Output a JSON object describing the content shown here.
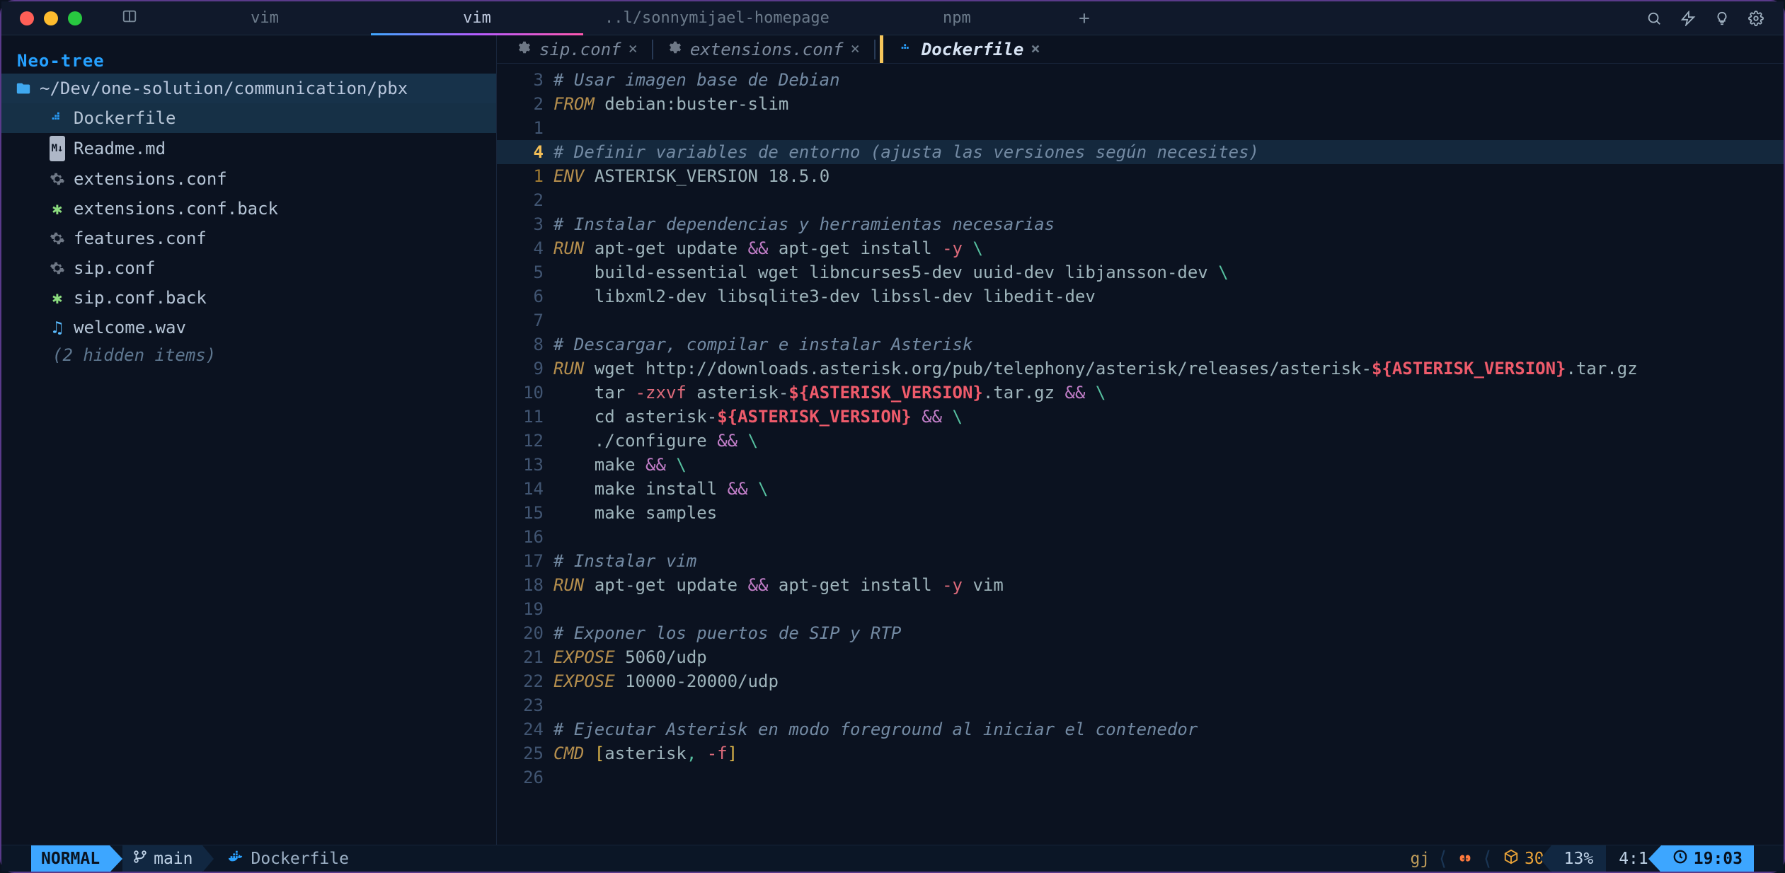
{
  "titlebar": {
    "tabs": [
      {
        "label": "vim",
        "active": false
      },
      {
        "label": "vim",
        "active": true
      },
      {
        "label": "..l/sonnymijael-homepage",
        "active": false
      },
      {
        "label": "npm",
        "active": false
      }
    ]
  },
  "sidebar": {
    "title": "Neo-tree",
    "root": "~/Dev/one-solution/communication/pbx",
    "items": [
      {
        "icon": "docker",
        "label": "Dockerfile",
        "selected": true
      },
      {
        "icon": "md",
        "label": "Readme.md"
      },
      {
        "icon": "gear",
        "label": "extensions.conf"
      },
      {
        "icon": "star",
        "label": "extensions.conf.back"
      },
      {
        "icon": "gear",
        "label": "features.conf"
      },
      {
        "icon": "gear",
        "label": "sip.conf"
      },
      {
        "icon": "star",
        "label": "sip.conf.back"
      },
      {
        "icon": "audio",
        "label": "welcome.wav"
      }
    ],
    "hidden": "(2 hidden items)"
  },
  "buffers": {
    "tabs": [
      {
        "icon": "gear",
        "name": "sip.conf",
        "close": true
      },
      {
        "icon": "gear",
        "name": "extensions.conf",
        "close": true
      },
      {
        "icon": "docker",
        "name": "Dockerfile",
        "close": true,
        "active": true,
        "modified": true
      }
    ]
  },
  "code": {
    "current_gutter": "4",
    "lines": [
      {
        "g": "3",
        "html": "<span class='tok-comment'># Usar imagen base de Debian</span>"
      },
      {
        "g": "2",
        "html": "<span class='tok-kw'>FROM</span> <span class='tok-text'>debian:buster-slim</span>"
      },
      {
        "g": "1",
        "html": ""
      },
      {
        "g": "4",
        "current": true,
        "html": "<span class='tok-comment'># Definir variables de entorno (ajusta las versiones según necesites)</span>"
      },
      {
        "g": "1",
        "near": true,
        "html": "<span class='tok-kw'>ENV</span> <span class='tok-text'>ASTERISK_VERSION 18.5.0</span>"
      },
      {
        "g": "2",
        "html": ""
      },
      {
        "g": "3",
        "html": "<span class='tok-comment'># Instalar dependencias y herramientas necesarias</span>"
      },
      {
        "g": "4",
        "html": "<span class='tok-kw'>RUN</span> <span class='tok-text'>apt-get update</span> <span class='tok-opamp'>&amp;&amp;</span> <span class='tok-text'>apt-get install </span><span class='tok-flag'>-y</span> <span class='tok-op'>\\</span>"
      },
      {
        "g": "5",
        "html": "    <span class='tok-text'>build-essential wget libncurses5-dev uuid-dev libjansson-dev</span> <span class='tok-op'>\\</span>"
      },
      {
        "g": "6",
        "html": "    <span class='tok-text'>libxml2-dev libsqlite3-dev libssl-dev libedit-dev</span>"
      },
      {
        "g": "7",
        "html": ""
      },
      {
        "g": "8",
        "html": "<span class='tok-comment'># Descargar, compilar e instalar Asterisk</span>"
      },
      {
        "g": "9",
        "html": "<span class='tok-kw'>RUN</span> <span class='tok-text'>wget http://downloads.asterisk.org/pub/telephony/asterisk/releases/asterisk-</span><span class='tok-var'>${ASTERISK_VERSION}</span><span class='tok-text'>.tar.gz</span>"
      },
      {
        "g": "10",
        "html": "    <span class='tok-text'>tar </span><span class='tok-flag'>-zxvf</span> <span class='tok-text'>asterisk-</span><span class='tok-var'>${ASTERISK_VERSION}</span><span class='tok-text'>.tar.gz</span> <span class='tok-opamp'>&amp;&amp;</span> <span class='tok-op'>\\</span>"
      },
      {
        "g": "11",
        "html": "    <span class='tok-text'>cd asterisk-</span><span class='tok-var'>${ASTERISK_VERSION}</span> <span class='tok-opamp'>&amp;&amp;</span> <span class='tok-op'>\\</span>"
      },
      {
        "g": "12",
        "html": "    <span class='tok-text'>./configure</span> <span class='tok-opamp'>&amp;&amp;</span> <span class='tok-op'>\\</span>"
      },
      {
        "g": "13",
        "html": "    <span class='tok-text'>make</span> <span class='tok-opamp'>&amp;&amp;</span> <span class='tok-op'>\\</span>"
      },
      {
        "g": "14",
        "html": "    <span class='tok-text'>make install</span> <span class='tok-opamp'>&amp;&amp;</span> <span class='tok-op'>\\</span>"
      },
      {
        "g": "15",
        "html": "    <span class='tok-text'>make samples</span>"
      },
      {
        "g": "16",
        "html": ""
      },
      {
        "g": "17",
        "html": "<span class='tok-comment'># Instalar vim</span>"
      },
      {
        "g": "18",
        "html": "<span class='tok-kw'>RUN</span> <span class='tok-text'>apt-get update</span> <span class='tok-opamp'>&amp;&amp;</span> <span class='tok-text'>apt-get install </span><span class='tok-flag'>-y</span> <span class='tok-text'>vim</span>"
      },
      {
        "g": "19",
        "html": ""
      },
      {
        "g": "20",
        "html": "<span class='tok-comment'># Exponer los puertos de SIP y RTP</span>"
      },
      {
        "g": "21",
        "html": "<span class='tok-kw'>EXPOSE</span> <span class='tok-text'>5060/udp</span>"
      },
      {
        "g": "22",
        "html": "<span class='tok-kw'>EXPOSE</span> <span class='tok-text'>10000-20000/udp</span>"
      },
      {
        "g": "23",
        "html": ""
      },
      {
        "g": "24",
        "html": "<span class='tok-comment'># Ejecutar Asterisk en modo foreground al iniciar el contenedor</span>"
      },
      {
        "g": "25",
        "html": "<span class='tok-kw'>CMD</span> <span class='tok-br'>[</span><span class='tok-text'>asterisk</span><span class='tok-op'>,</span> <span class='tok-flag'>-f</span><span class='tok-br'>]</span>"
      },
      {
        "g": "26",
        "html": ""
      }
    ]
  },
  "status": {
    "mode": "NORMAL",
    "branch": "main",
    "file": "Dockerfile",
    "gj": "gj",
    "cube_count": "30",
    "percent": "13%",
    "pos": "4:1",
    "time": "19:03"
  }
}
